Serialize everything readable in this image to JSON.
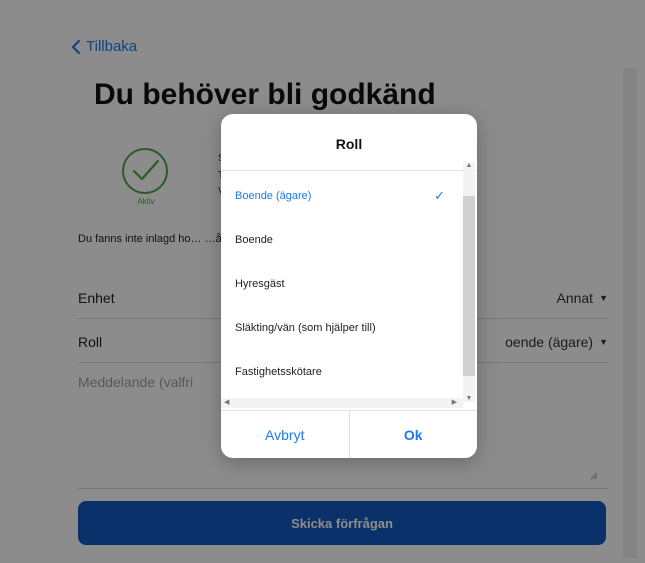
{
  "header": {
    "back_label": "Tillbaka",
    "title": "Du behöver bli godkänd"
  },
  "status": {
    "label": "Aktiv",
    "fragment_1": "S",
    "fragment_2": "T",
    "fragment_3": "V"
  },
  "info_text": "Du fanns inte inlagd ho… …å tillgång till boendets konto.",
  "form": {
    "unit": {
      "label": "Enhet",
      "value": "Annat"
    },
    "role": {
      "label": "Roll",
      "value": "oende (ägare)"
    },
    "message_placeholder": "Meddelande (valfri"
  },
  "submit_label": "Skicka förfrågan",
  "dialog": {
    "title": "Roll",
    "options": [
      {
        "label": "Boende (ägare)",
        "selected": true
      },
      {
        "label": "Boende",
        "selected": false
      },
      {
        "label": "Hyresgäst",
        "selected": false
      },
      {
        "label": "Släkting/vän (som hjälper till)",
        "selected": false
      },
      {
        "label": "Fastighetsskötare",
        "selected": false
      }
    ],
    "check_glyph": "✓",
    "cancel_label": "Avbryt",
    "ok_label": "Ok"
  },
  "colors": {
    "accent": "#1a7cf0",
    "submit": "#1359c0",
    "active_green": "#53a84c"
  }
}
